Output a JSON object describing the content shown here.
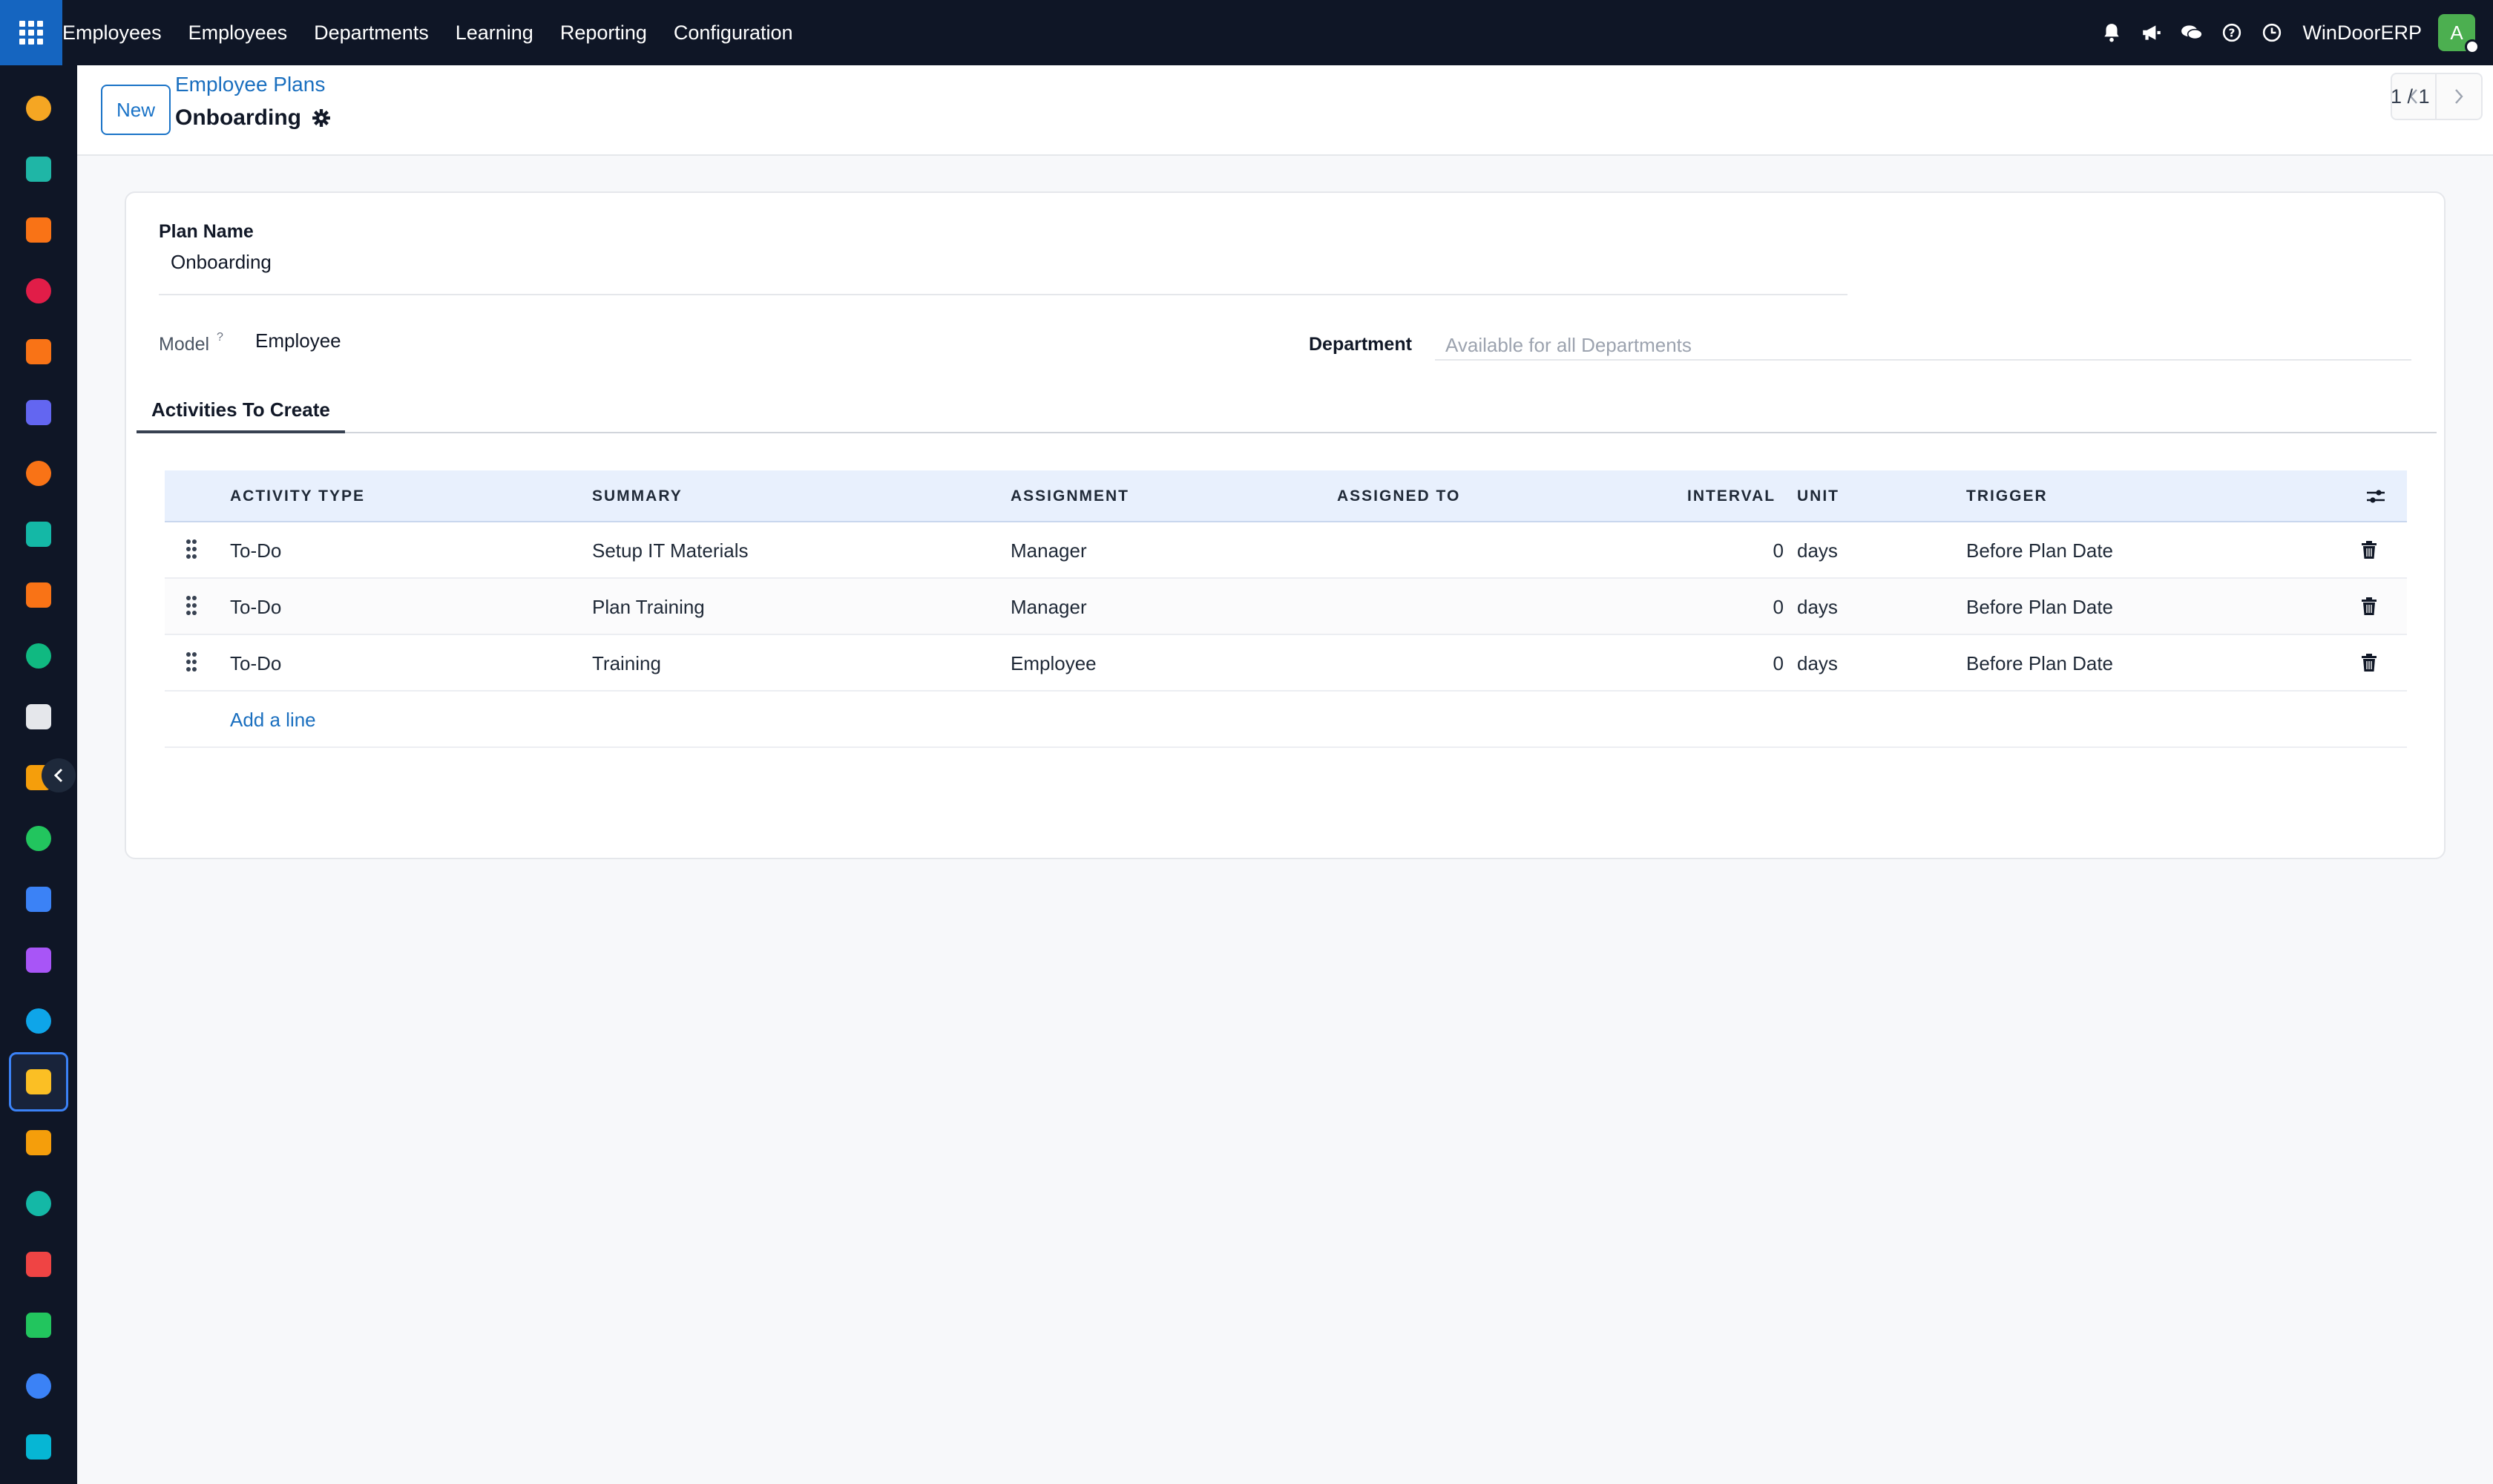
{
  "topbar": {
    "menu": [
      "Employees",
      "Employees",
      "Departments",
      "Learning",
      "Reporting",
      "Configuration"
    ],
    "icons": [
      "bell-icon",
      "megaphone-icon",
      "chat-icon",
      "help-icon",
      "clock-icon"
    ],
    "company": "WinDoorERP",
    "avatar_letter": "A",
    "avatar_color": "#4caf50"
  },
  "sidebar": {
    "apps": [
      {
        "name": "app-1",
        "color": "#f5a623"
      },
      {
        "name": "app-contacts",
        "color": "#1fb6a6"
      },
      {
        "name": "app-reports",
        "color": "#f97316"
      },
      {
        "name": "app-pie",
        "color": "#e11d48"
      },
      {
        "name": "app-chat",
        "color": "#f97316"
      },
      {
        "name": "app-mail",
        "color": "#6366f1"
      },
      {
        "name": "app-discuss",
        "color": "#f97316"
      },
      {
        "name": "app-inventory",
        "color": "#14b8a6"
      },
      {
        "name": "app-sales",
        "color": "#f97316"
      },
      {
        "name": "app-contacts-2",
        "color": "#10b981"
      },
      {
        "name": "app-box",
        "color": "#e5e7eb"
      },
      {
        "name": "app-studio",
        "color": "#f59e0b"
      },
      {
        "name": "app-todo",
        "color": "#22c55e"
      },
      {
        "name": "app-knowledge",
        "color": "#3b82f6"
      },
      {
        "name": "app-products",
        "color": "#a855f7"
      },
      {
        "name": "app-invoice",
        "color": "#0ea5e9"
      },
      {
        "name": "app-employees",
        "color": "#fbbf24"
      },
      {
        "name": "app-calendar",
        "color": "#f59e0b"
      },
      {
        "name": "app-sign",
        "color": "#14b8a6"
      },
      {
        "name": "app-dashboard",
        "color": "#ef4444"
      },
      {
        "name": "app-whatsapp",
        "color": "#22c55e"
      },
      {
        "name": "app-timer",
        "color": "#3b82f6"
      },
      {
        "name": "app-waves",
        "color": "#06b6d4"
      }
    ]
  },
  "control": {
    "new_label": "New",
    "breadcrumb_parent": "Employee Plans",
    "breadcrumb_current": "Onboarding",
    "pager": "1 / 1"
  },
  "form": {
    "plan_name_label": "Plan Name",
    "plan_name_value": "Onboarding",
    "model_label": "Model",
    "model_help": "?",
    "model_value": "Employee",
    "department_label": "Department",
    "department_placeholder": "Available for all Departments",
    "tab_label": "Activities To Create"
  },
  "table": {
    "headers": [
      "ACTIVITY TYPE",
      "SUMMARY",
      "ASSIGNMENT",
      "ASSIGNED TO",
      "INTERVAL",
      "UNIT",
      "TRIGGER"
    ],
    "rows": [
      {
        "activity_type": "To-Do",
        "summary": "Setup IT Materials",
        "assignment": "Manager",
        "assigned_to": "",
        "interval": "0",
        "unit": "days",
        "trigger": "Before Plan Date"
      },
      {
        "activity_type": "To-Do",
        "summary": "Plan Training",
        "assignment": "Manager",
        "assigned_to": "",
        "interval": "0",
        "unit": "days",
        "trigger": "Before Plan Date"
      },
      {
        "activity_type": "To-Do",
        "summary": "Training",
        "assignment": "Employee",
        "assigned_to": "",
        "interval": "0",
        "unit": "days",
        "trigger": "Before Plan Date"
      }
    ],
    "add_line": "Add a line"
  }
}
